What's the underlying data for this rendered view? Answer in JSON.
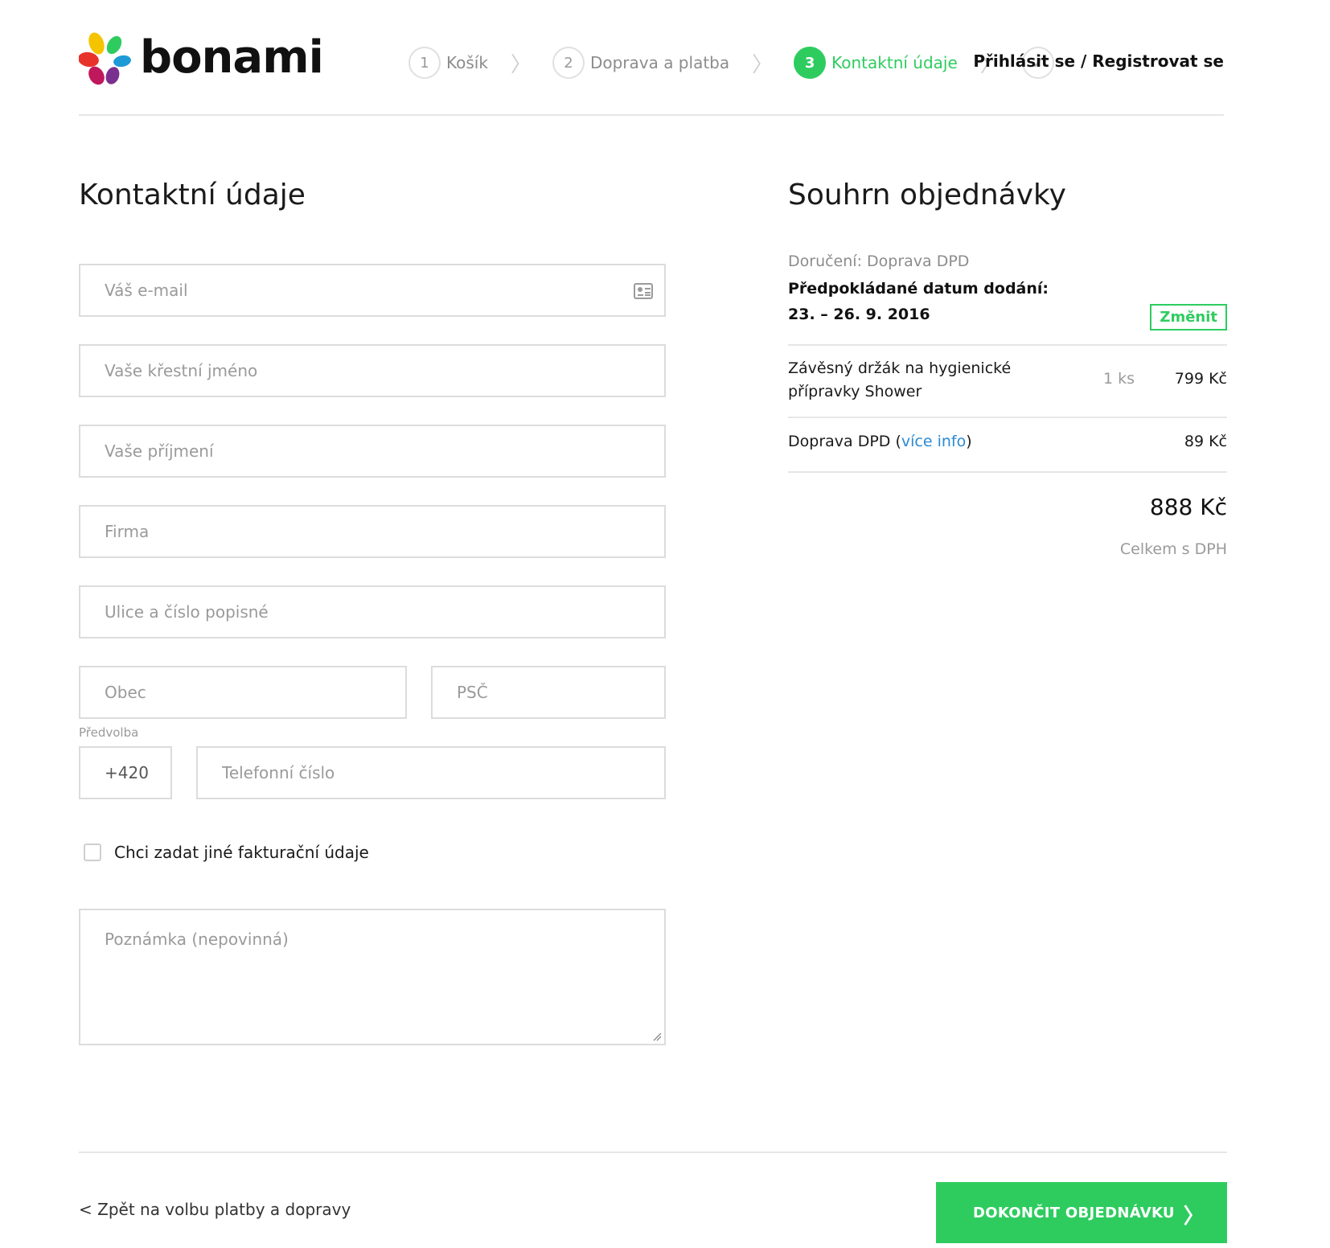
{
  "brand": {
    "name": "bonami"
  },
  "steps": [
    {
      "num": "1",
      "label": "Košík"
    },
    {
      "num": "2",
      "label": "Doprava a platba"
    },
    {
      "num": "3",
      "label": "Kontaktní údaje"
    }
  ],
  "step_separator": "〉",
  "step_done_icon": "✓",
  "header": {
    "login": "Přihlásit se / Registrovat se"
  },
  "form": {
    "title": "Kontaktní údaje",
    "email_placeholder": "Váš e-mail",
    "first_name_placeholder": "Vaše křestní jméno",
    "last_name_placeholder": "Vaše příjmení",
    "company_placeholder": "Firma",
    "street_placeholder": "Ulice a číslo popisné",
    "city_placeholder": "Obec",
    "zip_placeholder": "PSČ",
    "prefix_label": "Předvolba",
    "prefix_value": "+420",
    "phone_placeholder": "Telefonní číslo",
    "billing_checkbox_label": "Chci zadat jiné fakturační údaje",
    "note_placeholder": "Poznámka (nepovinná)"
  },
  "summary": {
    "title": "Souhrn objednávky",
    "delivery": "Doručení: Doprava DPD",
    "expected_label": "Předpokládané datum dodání:",
    "expected_date": "23. – 26. 9. 2016",
    "change_label": "Změnit",
    "item_name": "Závěsný držák na hygienické přípravky Shower",
    "item_qty": "1 ks",
    "item_price": "799 Kč",
    "shipping_label": "Doprava DPD",
    "shipping_link": "více info",
    "shipping_price": "89 Kč",
    "total": "888 Kč",
    "total_label": "Celkem s DPH"
  },
  "footer": {
    "back": "< Zpět na volbu platby a dopravy",
    "finish": "DOKONČIT OBJEDNÁVKU",
    "finish_chevron": "〉"
  },
  "colors": {
    "accent": "#2ecc5f",
    "link": "#2a8ad4"
  }
}
